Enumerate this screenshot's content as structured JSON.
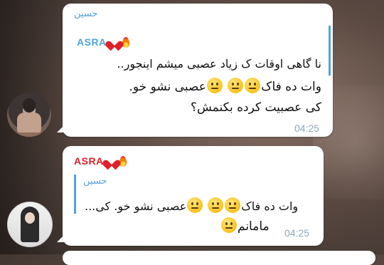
{
  "messages": [
    {
      "sender": "حسین",
      "reply_author": "ASRA",
      "reply_text": "نا  گاهی اوقات ک زیاد عصبی میشم اینجور..",
      "lines": [
        "وات ده فاک",
        "عصبی نشو خو.",
        "کی عصبیت کرده بکنمش؟"
      ],
      "emoji": "neutral-face",
      "time": "04:25"
    },
    {
      "sender": "ASRA",
      "reply_author": "حسین",
      "reply_text": "وات ده فاک",
      "reply_text_2": "عصبی نشو خو. کی...",
      "line": "مامانم",
      "emoji": "neutral-face",
      "time": "04:25"
    }
  ],
  "colors": {
    "sender_blue": "#4ea4d9",
    "asra_red": "#e0202a",
    "heart_red": "#e0202a",
    "time_gray": "#8aaab8",
    "bubble": "#ffffff"
  },
  "icons": {
    "heart": "red-heart-icon",
    "fire": "fire-icon",
    "emoji": "neutral-face-emoji"
  }
}
